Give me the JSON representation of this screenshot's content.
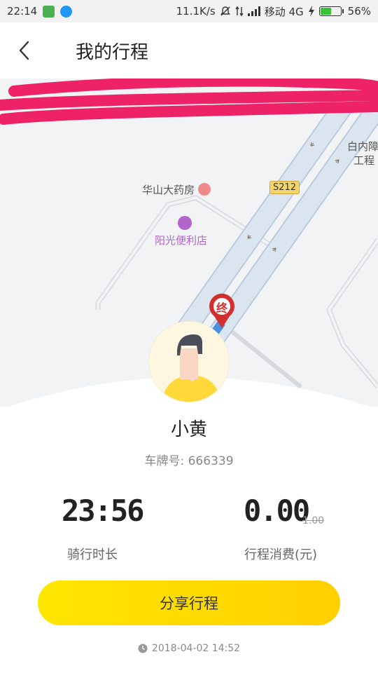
{
  "status_bar": {
    "time": "22:14",
    "network_speed": "11.1K/s",
    "carrier": "移动 4G",
    "battery": "56%",
    "battery_level": 0.56,
    "icons": [
      "silent-icon",
      "data-arrows-icon",
      "signal-icon",
      "charging-icon"
    ]
  },
  "header": {
    "title": "我的行程",
    "back_icon": "chevron-left-icon"
  },
  "map": {
    "pois": [
      {
        "name": "华山大药房",
        "icon": "pharmacy-icon"
      },
      {
        "name": "阳光便利店",
        "icon": "shop-icon"
      }
    ],
    "road_badge": "S212",
    "edge_label_1": "白内障",
    "edge_label_2": "工程",
    "end_marker": "终",
    "colors": {
      "road": "#dbe5ef",
      "pin": "#d32f2f",
      "poi_purple": "#b266cc"
    }
  },
  "rider": {
    "name": "小黄",
    "plate": "车牌号: 666339"
  },
  "stats": {
    "duration_value": "23:56",
    "duration_label": "骑行时长",
    "fee_value": "0.00",
    "fee_original": "1.00",
    "fee_label": "行程消费(元)"
  },
  "share_label": "分享行程",
  "timestamp": "2018-04-02 14:52"
}
